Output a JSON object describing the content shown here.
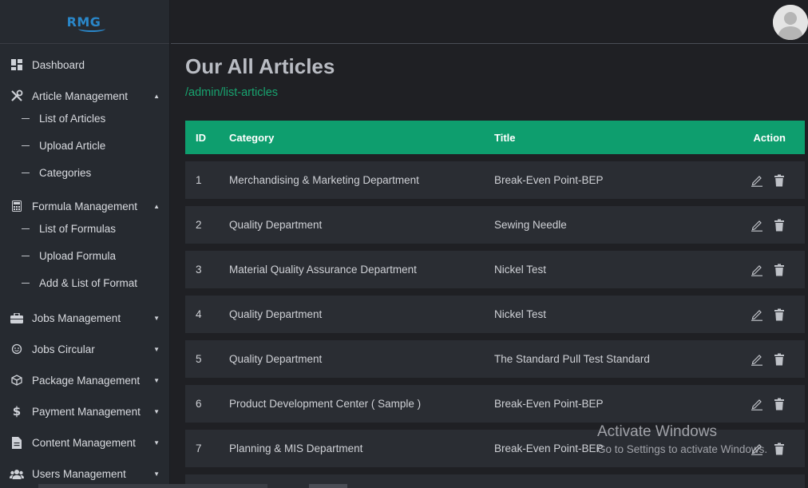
{
  "logo": {
    "text": "RMG"
  },
  "sidebar": {
    "items": [
      {
        "label": "Dashboard",
        "icon": "dashboard-icon",
        "caret": ""
      },
      {
        "label": "Article Management",
        "icon": "tools-icon",
        "caret": "▲",
        "sub": [
          "List of Articles",
          "Upload Article",
          "Categories"
        ]
      },
      {
        "label": "Formula Management",
        "icon": "calculator-icon",
        "caret": "▲",
        "sub": [
          "List of Formulas",
          "Upload Formula",
          "Add & List of Format"
        ]
      },
      {
        "label": "Jobs Management",
        "icon": "briefcase-icon",
        "caret": "▼"
      },
      {
        "label": "Jobs Circular",
        "icon": "circle-icon",
        "caret": "▼"
      },
      {
        "label": "Package Management",
        "icon": "package-icon",
        "caret": "▼"
      },
      {
        "label": "Payment Management",
        "icon": "dollar-icon",
        "caret": "▼"
      },
      {
        "label": "Content Management",
        "icon": "file-icon",
        "caret": "▼"
      },
      {
        "label": "Users Management",
        "icon": "users-icon",
        "caret": "▼"
      }
    ]
  },
  "header": {
    "avatar": "user-avatar-icon"
  },
  "main": {
    "title": "Our All Articles",
    "breadcrumb": "/admin/list-articles",
    "table": {
      "headers": {
        "id": "ID",
        "category": "Category",
        "title": "Title",
        "action": "Action"
      },
      "rows": [
        {
          "id": "1",
          "category": "Merchandising & Marketing Department",
          "title": "Break-Even Point-BEP"
        },
        {
          "id": "2",
          "category": "Quality Department",
          "title": "Sewing Needle"
        },
        {
          "id": "3",
          "category": "Material Quality Assurance Department",
          "title": "Nickel Test"
        },
        {
          "id": "4",
          "category": "Quality Department",
          "title": "Nickel Test"
        },
        {
          "id": "5",
          "category": "Quality Department",
          "title": "The Standard Pull Test Standard"
        },
        {
          "id": "6",
          "category": "Product Development Center ( Sample )",
          "title": "Break-Even Point-BEP"
        },
        {
          "id": "7",
          "category": "Planning & MIS Department",
          "title": "Break-Even Point-BEP"
        }
      ]
    }
  },
  "watermark": {
    "line1": "Activate Windows",
    "line2": "Go to Settings to activate Windows."
  },
  "colors": {
    "accent": "#0e9e6e",
    "breadcrumb": "#18a36f",
    "sidebar_bg": "#262a30",
    "page_bg": "#1f2024"
  }
}
